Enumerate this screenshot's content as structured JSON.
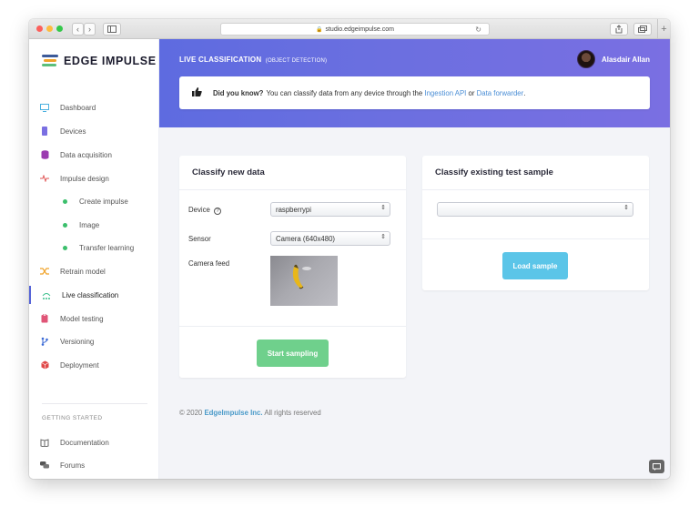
{
  "browser": {
    "url": "studio.edgeimpulse.com",
    "back": "‹",
    "forward": "›"
  },
  "logo": {
    "text": "EDGE IMPULSE"
  },
  "sidebar": {
    "items": [
      {
        "label": "Dashboard",
        "icon": "monitor-icon"
      },
      {
        "label": "Devices",
        "icon": "device-icon"
      },
      {
        "label": "Data acquisition",
        "icon": "database-icon"
      },
      {
        "label": "Impulse design",
        "icon": "pulse-icon"
      },
      {
        "label": "Create impulse",
        "icon": "dot-icon"
      },
      {
        "label": "Image",
        "icon": "dot-icon"
      },
      {
        "label": "Transfer learning",
        "icon": "dot-icon"
      },
      {
        "label": "Retrain model",
        "icon": "shuffle-icon"
      },
      {
        "label": "Live classification",
        "icon": "live-icon"
      },
      {
        "label": "Model testing",
        "icon": "clipboard-icon"
      },
      {
        "label": "Versioning",
        "icon": "branch-icon"
      },
      {
        "label": "Deployment",
        "icon": "box-icon"
      }
    ],
    "section_label": "GETTING STARTED",
    "getting_started": [
      {
        "label": "Documentation",
        "icon": "book-icon"
      },
      {
        "label": "Forums",
        "icon": "chat-icon"
      }
    ]
  },
  "header": {
    "title": "LIVE CLASSIFICATION",
    "subtitle": "(OBJECT DETECTION)",
    "user_name": "Alasdair Allan"
  },
  "tip": {
    "bold": "Did you know?",
    "text_before": "You can classify data from any device through the",
    "link1": "Ingestion API",
    "middle": "or",
    "link2": "Data forwarder",
    "end": "."
  },
  "classify_new": {
    "title": "Classify new data",
    "device_label": "Device",
    "device_value": "raspberrypi",
    "sensor_label": "Sensor",
    "sensor_value": "Camera (640x480)",
    "camera_label": "Camera feed",
    "button": "Start sampling"
  },
  "classify_existing": {
    "title": "Classify existing test sample",
    "select_value": "",
    "button": "Load sample"
  },
  "footer": {
    "prefix": "© 2020",
    "company": "EdgeImpulse Inc.",
    "suffix": "All rights reserved"
  },
  "colors": {
    "accent": "#5e6be0",
    "green_button": "#6fd08c",
    "blue_button": "#5bc5e8",
    "link": "#4c8fd6"
  }
}
